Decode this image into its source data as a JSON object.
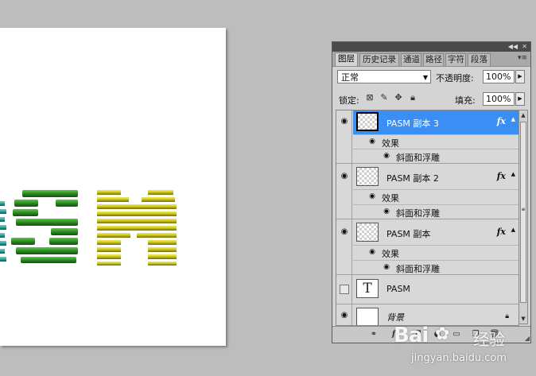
{
  "canvas": {
    "visible_text": "SM",
    "green": "#2e8b22",
    "yellow": "#c9c31a",
    "teal": "#2aa39a"
  },
  "panel": {
    "tabs": [
      {
        "label": "图层",
        "active": true
      },
      {
        "label": "历史记录"
      },
      {
        "label": "通道"
      },
      {
        "label": "路径"
      },
      {
        "label": "字符"
      },
      {
        "label": "段落"
      }
    ],
    "blend_mode": "正常",
    "opacity_label": "不透明度:",
    "opacity_value": "100%",
    "lock_label": "锁定:",
    "fill_label": "填充:",
    "fill_value": "100%",
    "fx_symbol": "fx",
    "layers": [
      {
        "name": "PASM 副本 3",
        "selected": true,
        "effects_label": "效果",
        "effect": "斜面和浮雕"
      },
      {
        "name": "PASM 副本 2",
        "effects_label": "效果",
        "effect": "斜面和浮雕"
      },
      {
        "name": "PASM 副本",
        "effects_label": "效果",
        "effect": "斜面和浮雕"
      },
      {
        "name": "PASM",
        "thumb_text": "T"
      },
      {
        "name": "背景"
      }
    ],
    "accent_selected": "#3b8ff4"
  },
  "watermark": {
    "logo_left": "Bai",
    "logo_right": "经验",
    "url": "jingyan.baidu.com"
  }
}
